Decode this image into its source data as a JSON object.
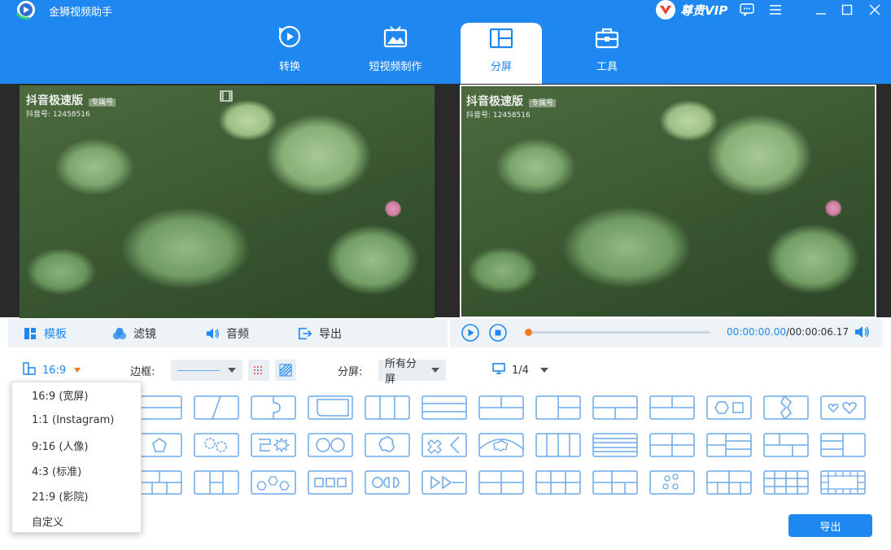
{
  "app": {
    "title": "金狮视频助手",
    "vip_label": "尊贵VIP"
  },
  "colors": {
    "brand": "#1e88f0",
    "toolbar_bg": "#eef3f8",
    "template_stroke": "#6aa8ea"
  },
  "tabs": [
    {
      "label": "转换",
      "icon": "convert-icon"
    },
    {
      "label": "短视频制作",
      "icon": "short-video-icon"
    },
    {
      "label": "分屏",
      "icon": "split-screen-icon",
      "active": true
    },
    {
      "label": "工具",
      "icon": "toolbox-icon"
    }
  ],
  "preview": {
    "watermark_title": "抖音极速版",
    "watermark_badge": "专属号",
    "watermark_id": "抖音号: 12458516",
    "watermark_id_right": "抖音号: 12458516"
  },
  "toolbar": {
    "template": "模板",
    "filter": "滤镜",
    "audio": "音频",
    "export": "导出"
  },
  "player": {
    "time_current": "00:00:00.00",
    "time_total": "/00:00:06.17",
    "progress": 0.0
  },
  "options": {
    "ratio": "16:9",
    "border_label": "边框:",
    "split_label": "分屏:",
    "split_value": "所有分屏",
    "page": "1/4"
  },
  "ratio_menu": [
    "16:9 (宽屏)",
    "1:1 (Instagram)",
    "9:16 (人像)",
    "4:3 (标准)",
    "21:9 (影院)",
    "自定义"
  ],
  "export_button": "导出"
}
